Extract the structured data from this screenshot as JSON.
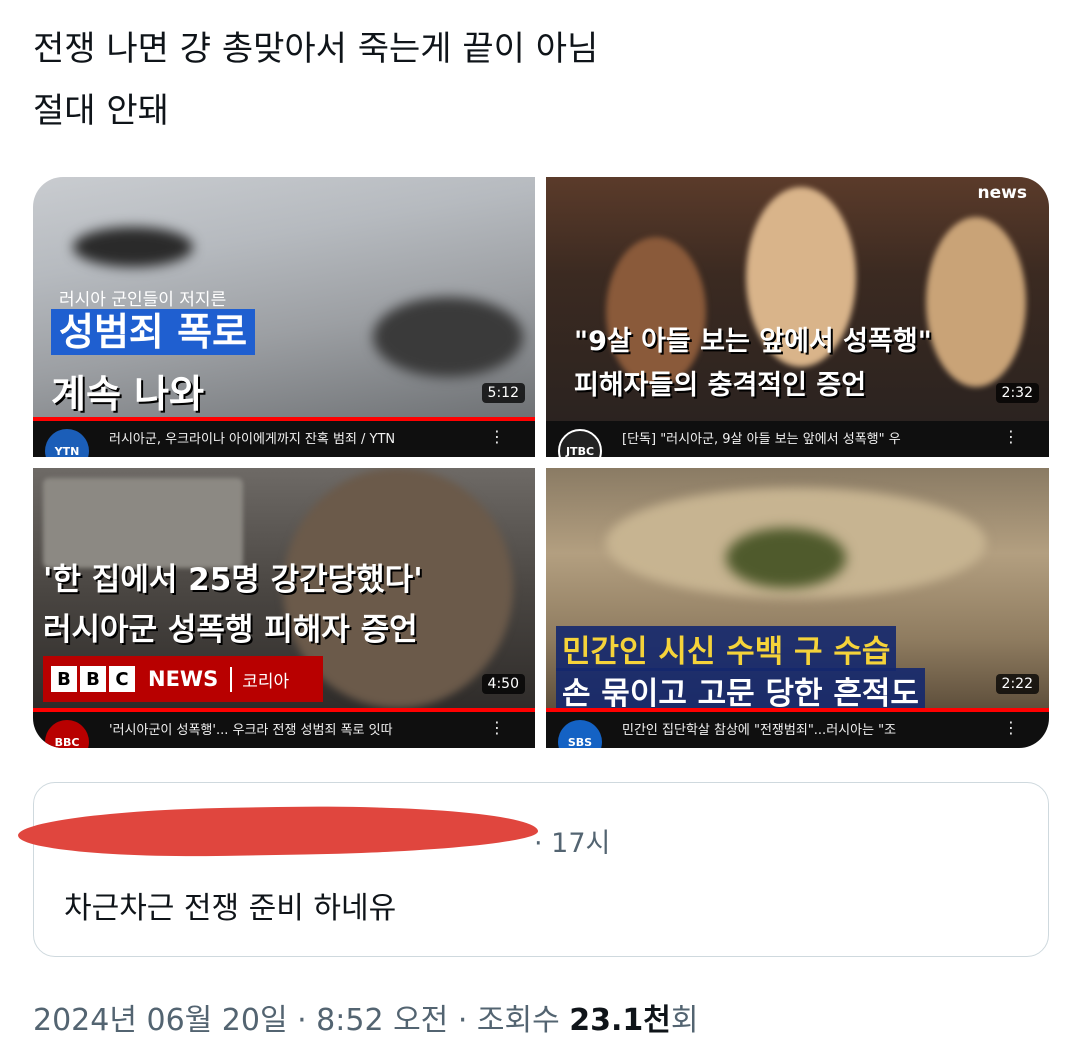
{
  "tweet": {
    "line1": "전쟁 나면 걍 총맞아서 죽는게 끝이 아님",
    "line2": "절대 안돼"
  },
  "videos": [
    {
      "caption_small": "러시아 군인들이 저지른",
      "caption_main": "성범죄 폭로",
      "caption_sub": "계속 나와",
      "duration": "5:12",
      "channel": "YTN",
      "title": "러시아군, 우크라이나 아이에게까지 잔혹 범죄 / YTN",
      "progress": 1.0
    },
    {
      "caption_main": "\"9살 아들 보는 앞에서 성폭행\"",
      "caption_sub": "피해자들의 충격적인 증언",
      "logo": "news",
      "duration": "2:32",
      "channel": "JTBC",
      "title": "[단독] \"러시아군, 9살 아들 보는 앞에서 성폭행\" 우",
      "progress": 0
    },
    {
      "caption_main": "'한 집에서 25명 강간당했다'",
      "caption_sub": "러시아군 성폭행 피해자 증언",
      "bbc_letters": [
        "B",
        "B",
        "C"
      ],
      "bbc_news": "NEWS",
      "bbc_korea": "코리아",
      "duration": "4:50",
      "channel": "BBC",
      "title": "'러시아군이 성폭행'... 우크라 전쟁 성범죄 폭로 잇따",
      "progress": 1.0
    },
    {
      "caption_main": "민간인 시신 수백 구 수습",
      "caption_sub": "손 묶이고 고문 당한 흔적도",
      "duration": "2:22",
      "channel": "SBS",
      "title": "민간인 집단학살 참상에 \"전쟁범죄\"...러시아는 \"조",
      "progress": 1.0
    }
  ],
  "quote": {
    "time": "· 17시",
    "text": "차근차근 전쟁 준비 하네유"
  },
  "footer": {
    "date": "2024년 06월 20일 · 8:52 오전 · 조회수 ",
    "views": "23.1천",
    "views_suffix": "회"
  }
}
